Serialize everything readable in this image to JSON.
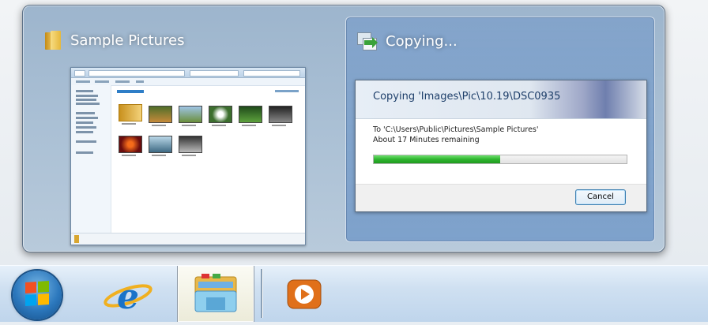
{
  "popup": {
    "left_thumbnail": {
      "title": "Sample Pictures",
      "icon": "folder-icon"
    },
    "right_thumbnail": {
      "title": "Copying...",
      "icon": "copy-files-icon",
      "dialog": {
        "heading": "Copying 'Images\\Pic\\10.19\\DSC0935",
        "destination": "To 'C:\\Users\\Public\\Pictures\\Sample Pictures'",
        "remaining": "About 17 Minutes remaining",
        "progress": 0.5,
        "cancel_label": "Cancel"
      }
    }
  },
  "taskbar": {
    "items": [
      {
        "name": "start-button",
        "icon": "windows-start-orb-icon"
      },
      {
        "name": "internet-explorer",
        "icon": "internet-explorer-icon"
      },
      {
        "name": "windows-explorer",
        "icon": "windows-explorer-icon",
        "active": true
      },
      {
        "name": "windows-media-player",
        "icon": "media-player-icon"
      }
    ]
  },
  "colors": {
    "progress_fill": "#2fb52f",
    "dialog_heading": "#1e3f6a"
  }
}
